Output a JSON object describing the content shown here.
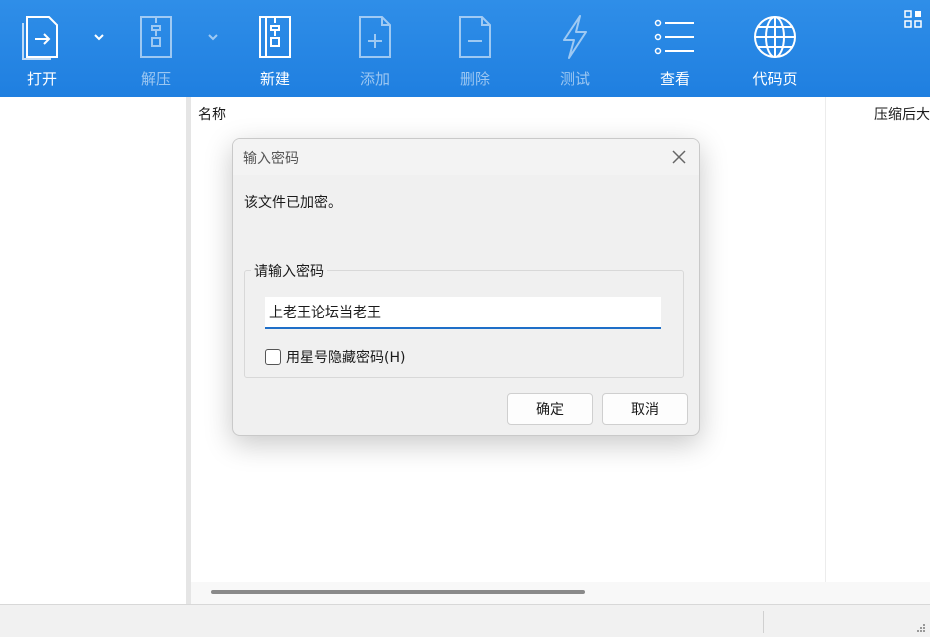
{
  "toolbar": {
    "items": [
      {
        "label": "打开",
        "icon": "open-file-icon"
      },
      {
        "label": "解压",
        "icon": "extract-icon"
      },
      {
        "label": "新建",
        "icon": "new-archive-icon"
      },
      {
        "label": "添加",
        "icon": "add-file-icon"
      },
      {
        "label": "删除",
        "icon": "delete-file-icon"
      },
      {
        "label": "测试",
        "icon": "test-icon"
      },
      {
        "label": "查看",
        "icon": "view-list-icon"
      },
      {
        "label": "代码页",
        "icon": "globe-icon"
      }
    ]
  },
  "file_list": {
    "columns": [
      "名称",
      "压缩后大"
    ]
  },
  "dialog": {
    "title": "输入密码",
    "message": "该文件已加密。",
    "group_label": "请输入密码",
    "password_value": "上老王论坛当老王",
    "mask_checkbox_label": "用星号隐藏密码(H)",
    "mask_checked": false,
    "ok_label": "确定",
    "cancel_label": "取消"
  },
  "colors": {
    "toolbar_bg": "#2088e4",
    "input_focus": "#1f6fc8"
  }
}
